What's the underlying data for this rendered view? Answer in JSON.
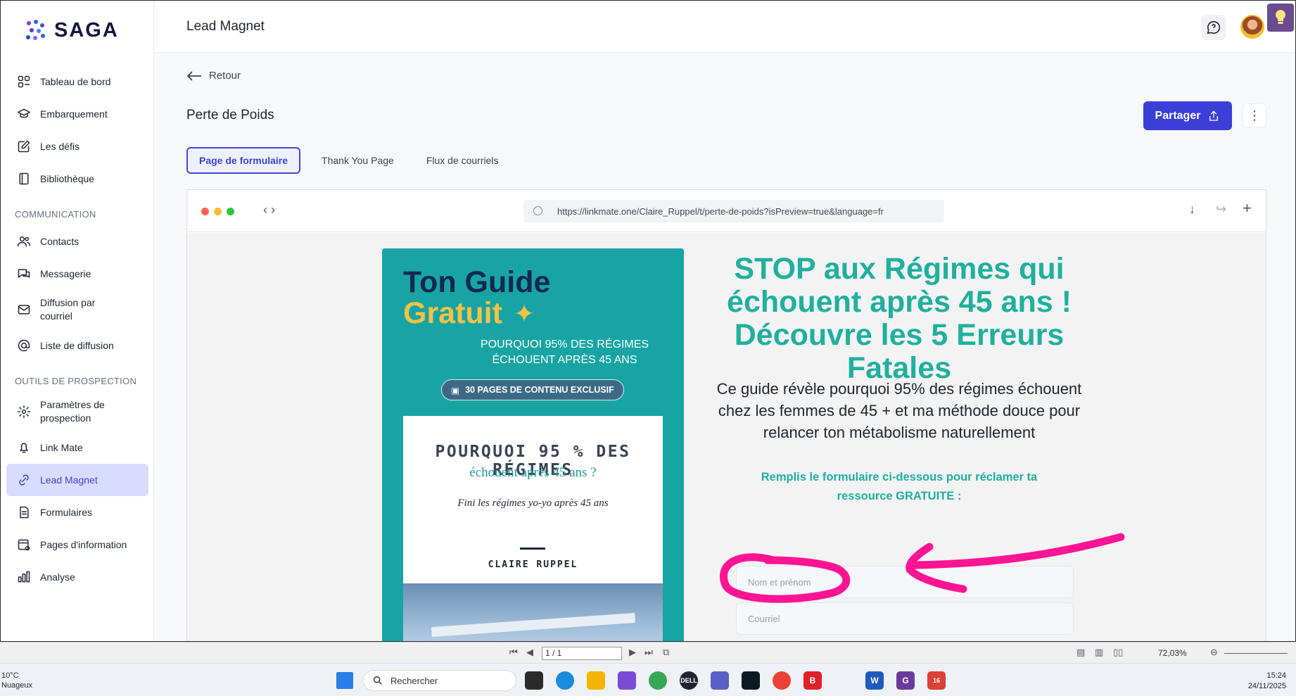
{
  "brand": {
    "name": "SAGA"
  },
  "sidebar": {
    "items_top": [
      {
        "label": "Tableau de bord",
        "icon": "dashboard-icon"
      },
      {
        "label": "Embarquement",
        "icon": "graduation-cap-icon"
      },
      {
        "label": "Les défis",
        "icon": "edit-square-icon"
      },
      {
        "label": "Bibliothèque",
        "icon": "book-icon"
      }
    ],
    "section_communication": "COMMUNICATION",
    "items_communication": [
      {
        "label": "Contacts",
        "icon": "users-icon"
      },
      {
        "label": "Messagerie",
        "icon": "chat-bubbles-icon"
      },
      {
        "label": "Diffusion par courriel",
        "icon": "envelope-icon"
      },
      {
        "label": "Liste de diffusion",
        "icon": "at-sign-icon"
      }
    ],
    "section_prospection": "OUTILS DE PROSPECTION",
    "items_prospection": [
      {
        "label": "Paramètres de prospection",
        "icon": "gear-icon"
      },
      {
        "label": "Link Mate",
        "icon": "bell-link-icon"
      },
      {
        "label": "Lead Magnet",
        "icon": "magnet-link-icon",
        "active": true
      },
      {
        "label": "Formulaires",
        "icon": "form-icon"
      },
      {
        "label": "Pages d'information",
        "icon": "info-page-icon"
      },
      {
        "label": "Analyse",
        "icon": "bar-chart-icon"
      }
    ]
  },
  "topbar": {
    "heading": "Lead Magnet"
  },
  "main": {
    "back_label": "Retour",
    "title": "Perte de Poids",
    "share_label": "Partager",
    "more_label": "⋮",
    "tabs": [
      {
        "label": "Page de formulaire",
        "active": true
      },
      {
        "label": "Thank You Page"
      },
      {
        "label": "Flux de courriels"
      }
    ]
  },
  "browser": {
    "url": "https://linkmate.one/Claire_Ruppel/t/perte-de-poids?isPreview=true&language=fr",
    "nav_code": "‹ ›"
  },
  "guide": {
    "title_line1": "Ton Guide",
    "title_line2": "Gratuit",
    "subtitle_line1": "POURQUOI 95% DES RÉGIMES",
    "subtitle_line2": "ÉCHOUENT APRÈS 45 ANS",
    "badge": "30 PAGES DE CONTENU EXCLUSIF",
    "book_title": "POURQUOI 95 % DES RÉGIMES",
    "book_subtitle": "échouent après 45 ans ?",
    "book_tagline": "Fini les régimes yo-yo après 45 ans",
    "book_author": "CLAIRE RUPPEL"
  },
  "landing": {
    "headline": "STOP aux Régimes qui échouent après 45 ans ! Découvre les 5 Erreurs Fatales",
    "description": "Ce guide révèle pourquoi 95% des régimes échouent chez les femmes de 45 + et ma méthode douce pour relancer ton métabolisme naturellement",
    "cta": "Remplis le formulaire ci-dessous pour réclamer ta ressource GRATUITE :",
    "field_name_placeholder": "Nom et prénom",
    "field_email_placeholder": "Courriel"
  },
  "pdf_viewer": {
    "page": "1 / 1",
    "zoom": "72,03%"
  },
  "taskbar": {
    "weather_temp": "10°C",
    "weather_desc": "Nuageux",
    "search_placeholder": "Rechercher",
    "time": "15:24",
    "date": "24/11/2025",
    "badge_count_1": "16"
  },
  "colors": {
    "accent": "#3b3fd8",
    "teal": "#18a4a4",
    "headline": "#1fb09e",
    "annotation": "#ff1493",
    "gold": "#f6c244"
  }
}
